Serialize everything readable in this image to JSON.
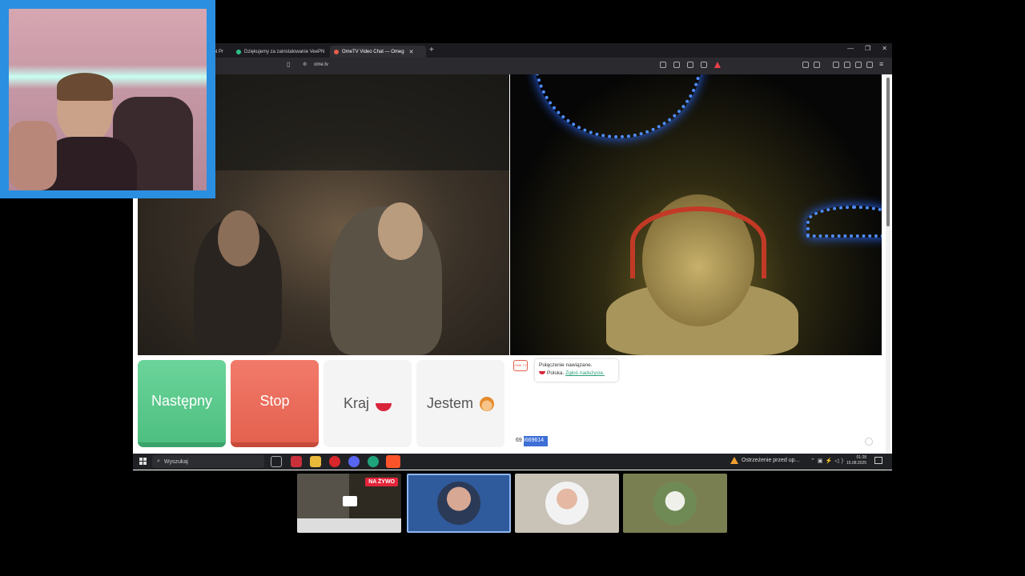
{
  "browser": {
    "tabs": [
      {
        "label": "N Pr",
        "active": false
      },
      {
        "label": "Dziękujemy za zainstalowanie VeePN",
        "active": false
      },
      {
        "label": "OmeTV Video Chat — Omeg",
        "active": true
      }
    ],
    "new_tab": "+",
    "url": "ome.tv"
  },
  "controls": {
    "next_label": "Następny",
    "stop_label": "Stop",
    "country_label": "Kraj",
    "gender_label": "Jestem",
    "next_color": "#5ccb8d",
    "stop_color": "#ea6b59"
  },
  "chat": {
    "logo": "OME TV",
    "system_line1": "Połączenie nawiązane.",
    "country": "Polska.",
    "report_link": "Zgłoś nadużycie.",
    "input_prefix": "69",
    "input_selected": "6669614"
  },
  "taskbar": {
    "search_placeholder": "Wyszukaj",
    "warning_text": "Ostrzeżenie przed up...",
    "time": "01:28",
    "date": "15.08.2025"
  },
  "stream": {
    "live_badge": "NA ŻYWO"
  },
  "colors": {
    "webcam_border": "#2a8fe0",
    "active_thumb_border": "#8fb8ef"
  }
}
